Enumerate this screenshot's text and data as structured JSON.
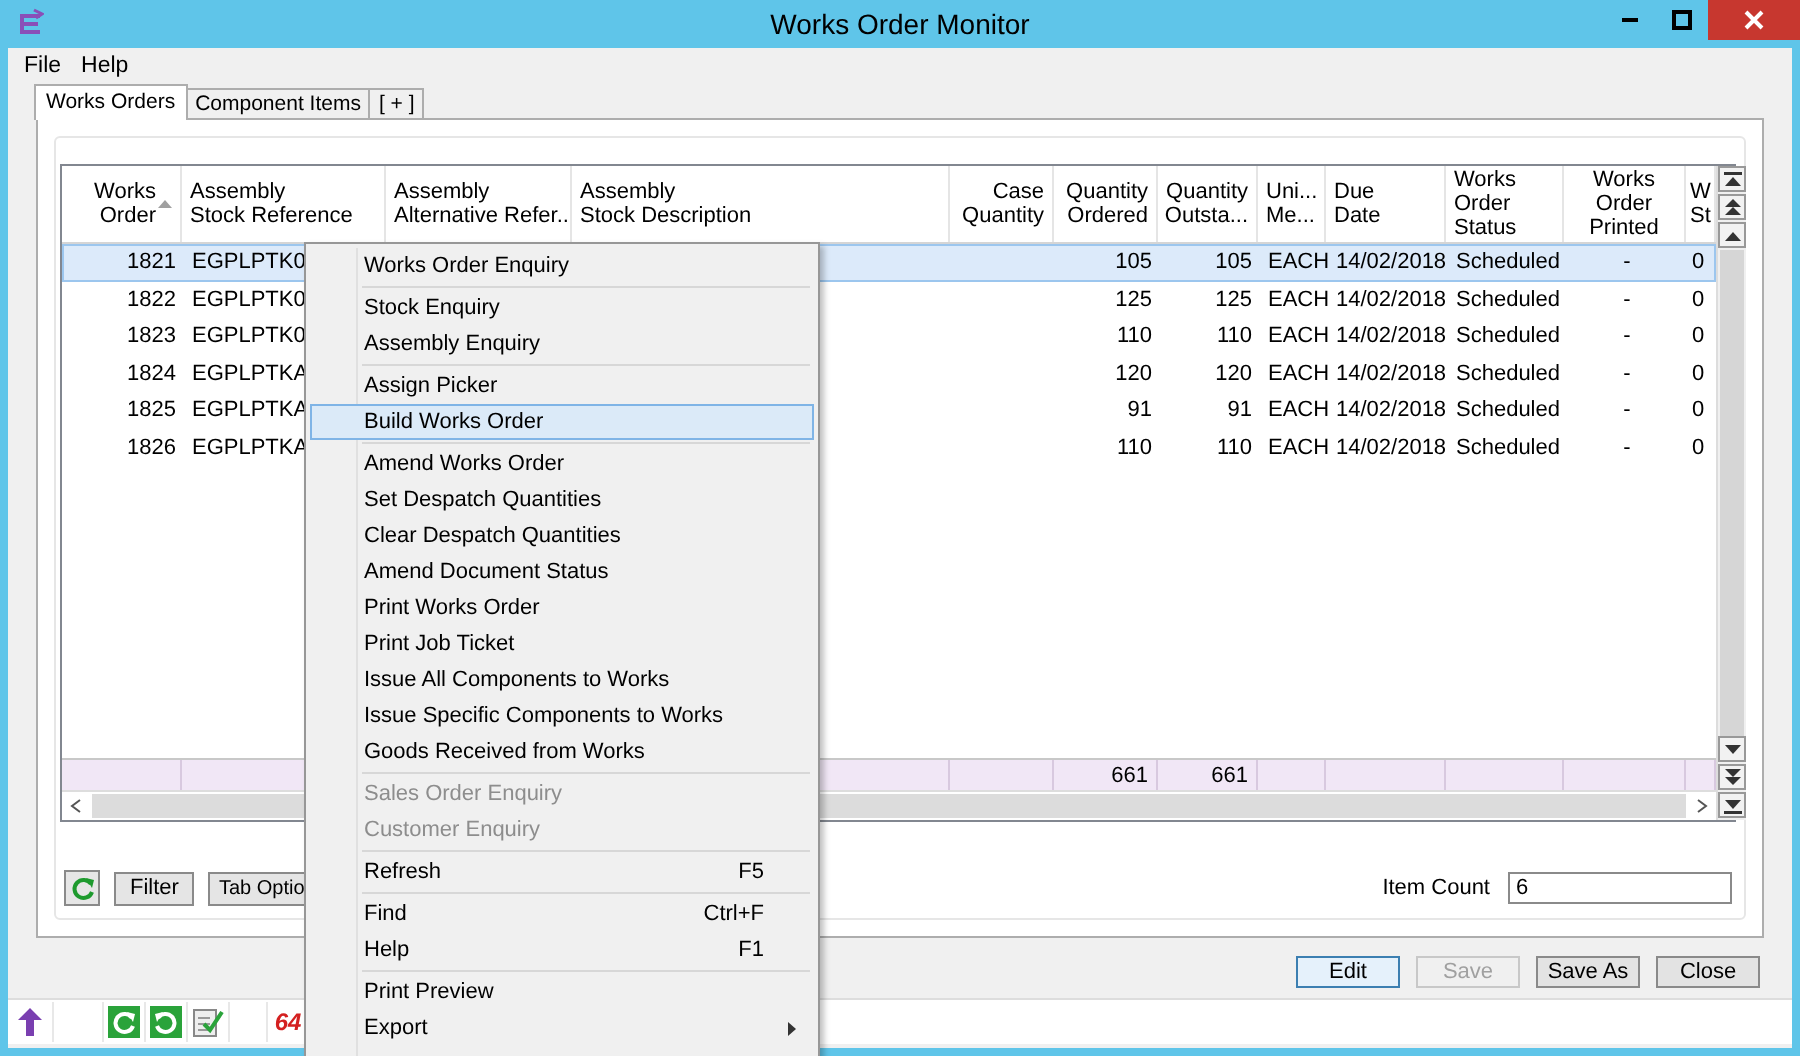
{
  "window": {
    "title": "Works Order Monitor"
  },
  "menu_bar": [
    "File",
    "Help"
  ],
  "tabs": [
    {
      "label": "Works Orders",
      "selected": true
    },
    {
      "label": "Component Items",
      "selected": false
    },
    {
      "label": "[ + ]",
      "selected": false
    }
  ],
  "table": {
    "columns": [
      {
        "lines": [
          "Works",
          "Order"
        ],
        "sorted": true
      },
      {
        "lines": [
          "Assembly",
          "Stock Reference"
        ],
        "sorted": false
      },
      {
        "lines": [
          "Assembly",
          "Alternative Refer..."
        ],
        "sorted": false
      },
      {
        "lines": [
          "Assembly",
          "Stock Description"
        ],
        "sorted": false
      },
      {
        "lines": [
          "Case",
          "Quantity"
        ],
        "sorted": false
      },
      {
        "lines": [
          "Quantity",
          "Ordered"
        ],
        "sorted": false
      },
      {
        "lines": [
          "Quantity",
          "Outsta..."
        ],
        "sorted": false
      },
      {
        "lines": [
          "Uni...",
          "Me..."
        ],
        "sorted": false
      },
      {
        "lines": [
          "Due",
          "Date"
        ],
        "sorted": false
      },
      {
        "lines": [
          "Works",
          "Order",
          "Status"
        ],
        "sorted": false
      },
      {
        "lines": [
          "Works",
          "Order",
          "Printed"
        ],
        "sorted": false
      },
      {
        "lines": [
          "W",
          "St"
        ],
        "sorted": false
      }
    ],
    "rows": [
      {
        "selected": true,
        "order": "1821",
        "stock_ref": "EGPLPTK0",
        "ordered": "105",
        "outstanding": "105",
        "unit": "EACH",
        "due": "14/02/2018",
        "status": "Scheduled",
        "printed": "-",
        "column_12": "0"
      },
      {
        "selected": false,
        "order": "1822",
        "stock_ref": "EGPLPTK0",
        "ordered": "125",
        "outstanding": "125",
        "unit": "EACH",
        "due": "14/02/2018",
        "status": "Scheduled",
        "printed": "-",
        "column_12": "0"
      },
      {
        "selected": false,
        "order": "1823",
        "stock_ref": "EGPLPTK0",
        "ordered": "110",
        "outstanding": "110",
        "unit": "EACH",
        "due": "14/02/2018",
        "status": "Scheduled",
        "printed": "-",
        "column_12": "0"
      },
      {
        "selected": false,
        "order": "1824",
        "stock_ref": "EGPLPTKA",
        "ordered": "120",
        "outstanding": "120",
        "unit": "EACH",
        "due": "14/02/2018",
        "status": "Scheduled",
        "printed": "-",
        "column_12": "0"
      },
      {
        "selected": false,
        "order": "1825",
        "stock_ref": "EGPLPTKA",
        "ordered": "91",
        "outstanding": "91",
        "unit": "EACH",
        "due": "14/02/2018",
        "status": "Scheduled",
        "printed": "-",
        "column_12": "0"
      },
      {
        "selected": false,
        "order": "1826",
        "stock_ref": "EGPLPTKA",
        "ordered": "110",
        "outstanding": "110",
        "unit": "EACH",
        "due": "14/02/2018",
        "status": "Scheduled",
        "printed": "-",
        "column_12": "0"
      }
    ],
    "totals": {
      "ordered": "661",
      "outstanding": "661"
    }
  },
  "toolbar": {
    "buttons": [
      "Filter",
      "Tab Optio"
    ],
    "item_count": {
      "label": "Item Count",
      "value": "6"
    }
  },
  "buttons": [
    {
      "label": "Edit",
      "disabled": false,
      "focused": true
    },
    {
      "label": "Save",
      "disabled": true,
      "focused": false
    },
    {
      "label": "Save As",
      "disabled": false,
      "focused": false
    },
    {
      "label": "Close",
      "disabled": false,
      "focused": false
    }
  ],
  "status_bar": {
    "badge": "64"
  },
  "context_menu": [
    {
      "kind": "item",
      "label": "Works Order Enquiry",
      "disabled": false,
      "selected": false,
      "submenu": false
    },
    {
      "kind": "separator"
    },
    {
      "kind": "item",
      "label": "Stock Enquiry",
      "disabled": false,
      "selected": false,
      "submenu": false
    },
    {
      "kind": "item",
      "label": "Assembly Enquiry",
      "disabled": false,
      "selected": false,
      "submenu": false
    },
    {
      "kind": "separator"
    },
    {
      "kind": "item",
      "label": "Assign Picker",
      "disabled": false,
      "selected": false,
      "submenu": false
    },
    {
      "kind": "item",
      "label": "Build Works Order",
      "disabled": false,
      "selected": true,
      "submenu": false
    },
    {
      "kind": "separator"
    },
    {
      "kind": "item",
      "label": "Amend Works Order",
      "disabled": false,
      "selected": false,
      "submenu": false
    },
    {
      "kind": "item",
      "label": "Set Despatch Quantities",
      "disabled": false,
      "selected": false,
      "submenu": false
    },
    {
      "kind": "item",
      "label": "Clear Despatch Quantities",
      "disabled": false,
      "selected": false,
      "submenu": false
    },
    {
      "kind": "item",
      "label": "Amend Document Status",
      "disabled": false,
      "selected": false,
      "submenu": false
    },
    {
      "kind": "item",
      "label": "Print Works Order",
      "disabled": false,
      "selected": false,
      "submenu": false
    },
    {
      "kind": "item",
      "label": "Print Job Ticket",
      "disabled": false,
      "selected": false,
      "submenu": false
    },
    {
      "kind": "item",
      "label": "Issue All Components to Works",
      "disabled": false,
      "selected": false,
      "submenu": false
    },
    {
      "kind": "item",
      "label": "Issue Specific Components to Works",
      "disabled": false,
      "selected": false,
      "submenu": false
    },
    {
      "kind": "item",
      "label": "Goods Received from Works",
      "disabled": false,
      "selected": false,
      "submenu": false
    },
    {
      "kind": "separator"
    },
    {
      "kind": "item",
      "label": "Sales Order Enquiry",
      "disabled": true,
      "selected": false,
      "submenu": false
    },
    {
      "kind": "item",
      "label": "Customer Enquiry",
      "disabled": true,
      "selected": false,
      "submenu": false
    },
    {
      "kind": "separator"
    },
    {
      "kind": "item",
      "label": "Refresh",
      "shortcut": "F5",
      "disabled": false,
      "selected": false,
      "submenu": false
    },
    {
      "kind": "separator"
    },
    {
      "kind": "item",
      "label": "Find",
      "shortcut": "Ctrl+F",
      "disabled": false,
      "selected": false,
      "submenu": false
    },
    {
      "kind": "item",
      "label": "Help",
      "shortcut": "F1",
      "disabled": false,
      "selected": false,
      "submenu": false
    },
    {
      "kind": "separator"
    },
    {
      "kind": "item",
      "label": "Print Preview",
      "disabled": false,
      "selected": false,
      "submenu": false
    },
    {
      "kind": "item",
      "label": "Export",
      "disabled": false,
      "selected": false,
      "submenu": true
    }
  ]
}
